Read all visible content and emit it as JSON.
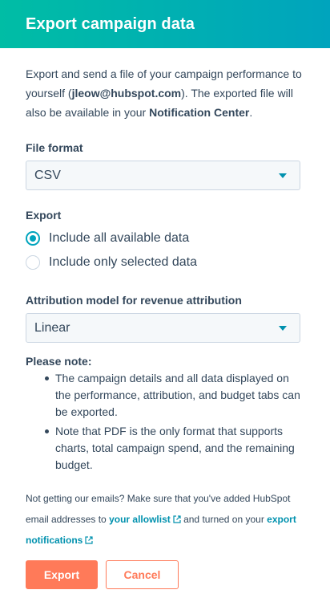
{
  "header": {
    "title": "Export campaign data"
  },
  "intro": {
    "part1": "Export and send a file of your campaign performance to yourself (",
    "email": "jleow@hubspot.com",
    "part2": "). The exported file will also be available in your ",
    "notification_center": "Notification Center",
    "part3": "."
  },
  "file_format": {
    "label": "File format",
    "value": "CSV"
  },
  "export": {
    "label": "Export",
    "options": [
      {
        "label": "Include all available data",
        "selected": true
      },
      {
        "label": "Include only selected data",
        "selected": false
      }
    ]
  },
  "attribution": {
    "label": "Attribution model for revenue attribution",
    "value": "Linear"
  },
  "notes": {
    "title": "Please note:",
    "items": [
      "The campaign details and all data displayed on the performance, attribution, and budget tabs can be exported.",
      "Note that PDF is the only format that supports charts, total campaign spend, and the remaining budget."
    ]
  },
  "footer": {
    "text1": "Not getting our emails? Make sure that you've added HubSpot email addresses to ",
    "allowlist_link": "your allowlist",
    "text2": " and turned on your ",
    "notifications_link": "export notifications"
  },
  "buttons": {
    "export": "Export",
    "cancel": "Cancel"
  },
  "colors": {
    "accent": "#00a4bd",
    "primary": "#ff7a59",
    "link": "#0091ae",
    "text": "#33475b"
  },
  "icons": {
    "external_link": "external-link-icon",
    "caret": "caret-down-icon"
  }
}
